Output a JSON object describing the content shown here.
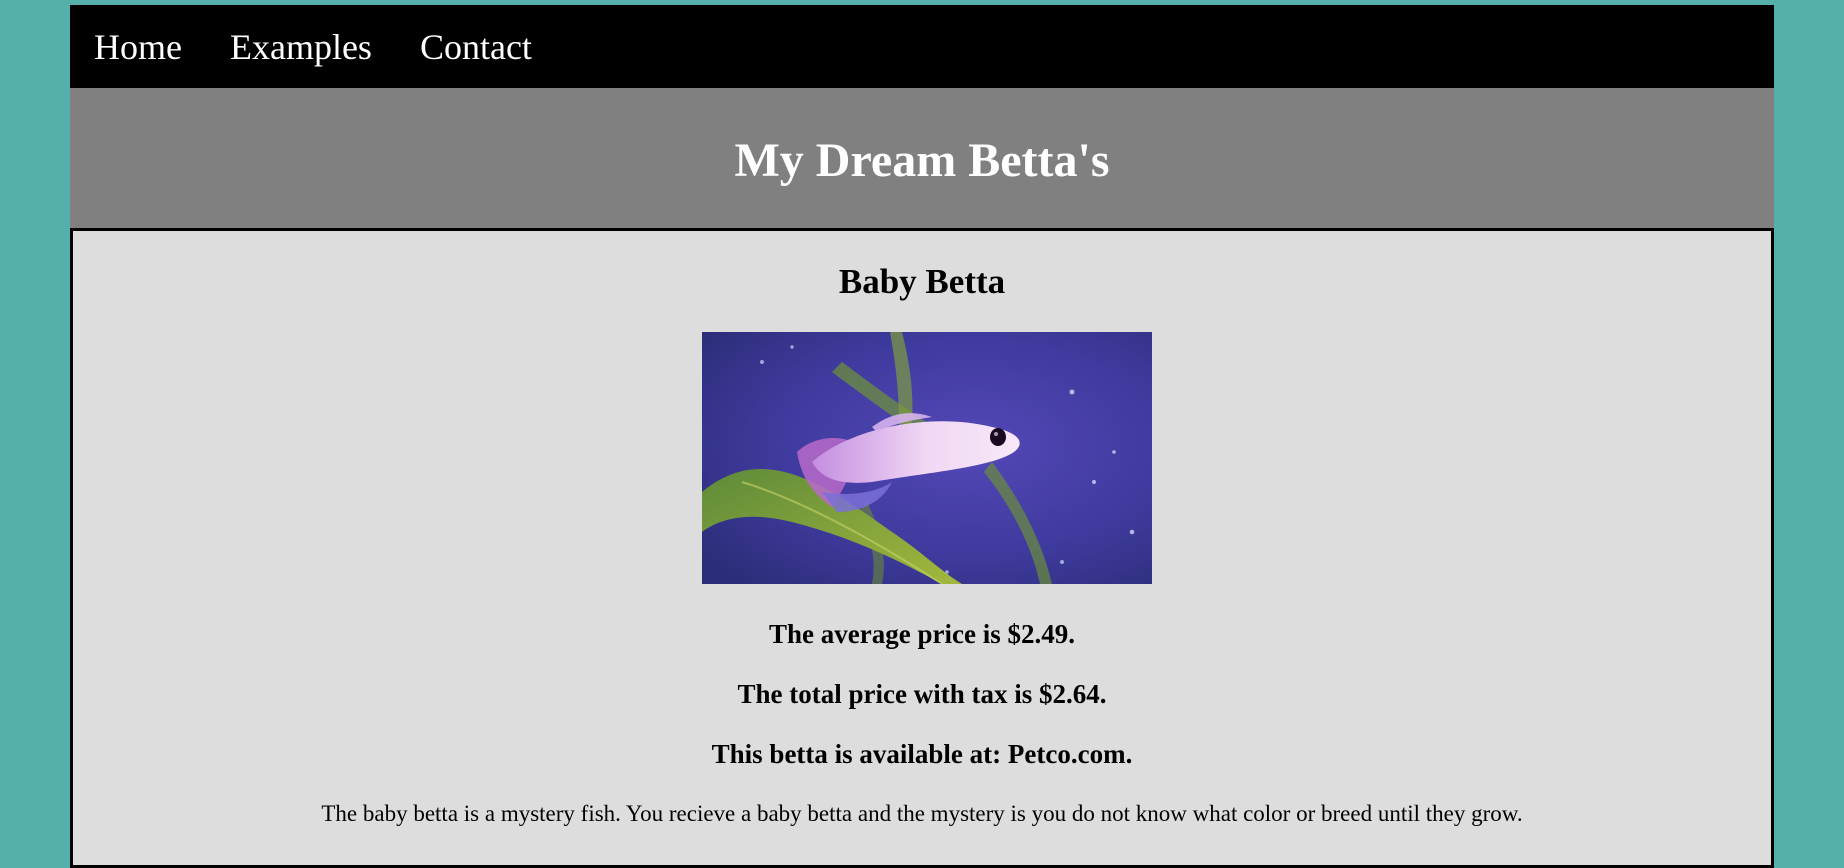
{
  "nav": {
    "items": [
      {
        "label": "Home"
      },
      {
        "label": "Examples"
      },
      {
        "label": "Contact"
      }
    ]
  },
  "header": {
    "title": "My Dream Betta's"
  },
  "product": {
    "title": "Baby Betta",
    "image_alt": "betta-fish-photo",
    "average_price": "The average price is $2.49.",
    "total_price": "The total price with tax is $2.64.",
    "availability": "This betta is available at: Petco.com.",
    "description": "The baby betta is a mystery fish. You recieve a baby betta and the mystery is you do not know what color or breed until they grow."
  },
  "colors": {
    "page_background": "#55b0ac",
    "nav_background": "#000000",
    "header_background": "#808080",
    "content_background": "#dddddd"
  }
}
